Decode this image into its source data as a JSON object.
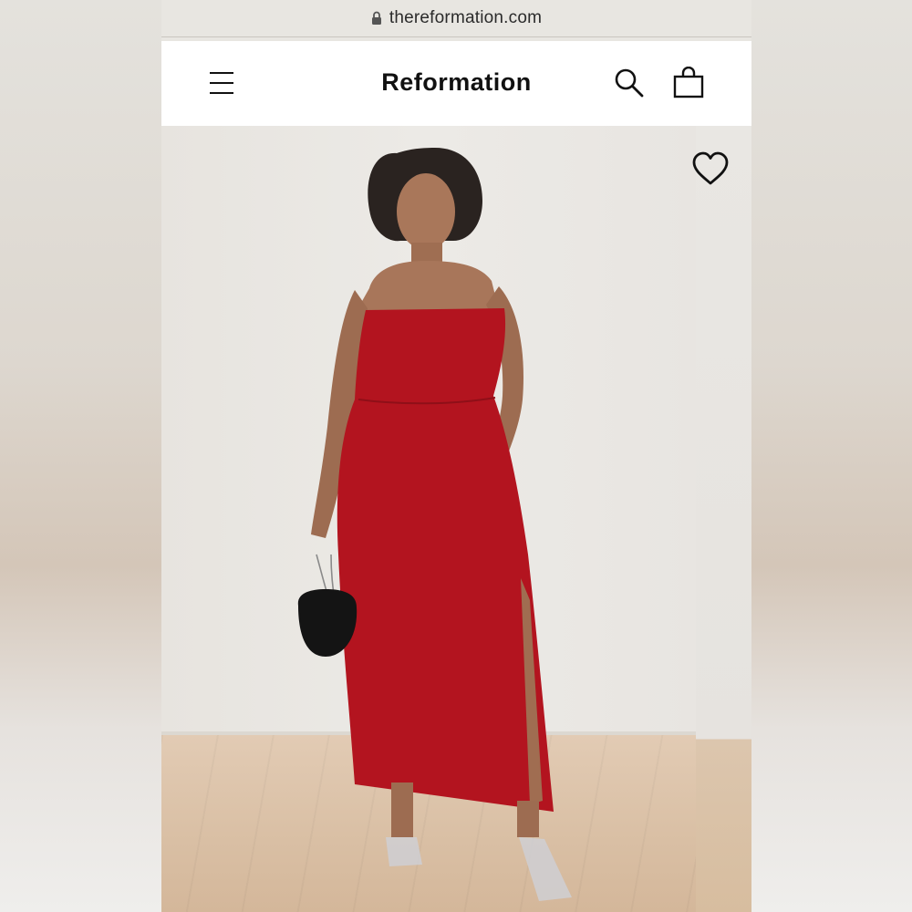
{
  "browser": {
    "url": "thereformation.com",
    "lock_icon": "lock-icon"
  },
  "header": {
    "brand": "Reformation",
    "menu_icon": "hamburger-menu-icon",
    "search_icon": "search-icon",
    "bag_icon": "shopping-bag-icon"
  },
  "product_image": {
    "wishlist_icon": "heart-icon",
    "dress_color": "#b3141f"
  }
}
